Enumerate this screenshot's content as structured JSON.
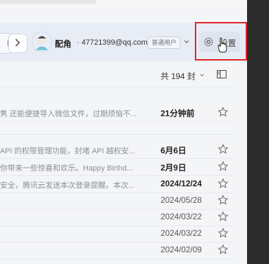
{
  "header": {
    "crumb_glyph": "l",
    "user_name": "配角",
    "user_email": "· 47721399@qq.com",
    "user_badge": "普通用户",
    "settings_label": "设置"
  },
  "list": {
    "count_label": "共 194 封"
  },
  "rows": [
    {
      "summary": "隽 还能便捷导入微信文件，过期烦恼不...",
      "date": "21分钟前",
      "bold": true
    },
    {
      "summary": "API 的权限管理功能，封堵 API 越权安...",
      "date": "6月6日",
      "bold": true
    },
    {
      "summary": "你带来一些惊喜和欢乐。Happy Birthd...",
      "date": "2月9日",
      "bold": true
    },
    {
      "summary": "安全，腾讯云发送本次登录提醒。本次...",
      "date": "2024/12/24",
      "bold": true
    },
    {
      "summary": "",
      "date": "2024/05/28",
      "bold": false
    },
    {
      "summary": "",
      "date": "2024/03/22",
      "bold": false
    },
    {
      "summary": "",
      "date": "2024/03/22",
      "bold": false
    },
    {
      "summary": "",
      "date": "2024/02/09",
      "bold": false
    }
  ],
  "colors": {
    "highlight": "#e02424",
    "header_bg": "#e8edf5",
    "page_bg": "#f4f5f7"
  }
}
